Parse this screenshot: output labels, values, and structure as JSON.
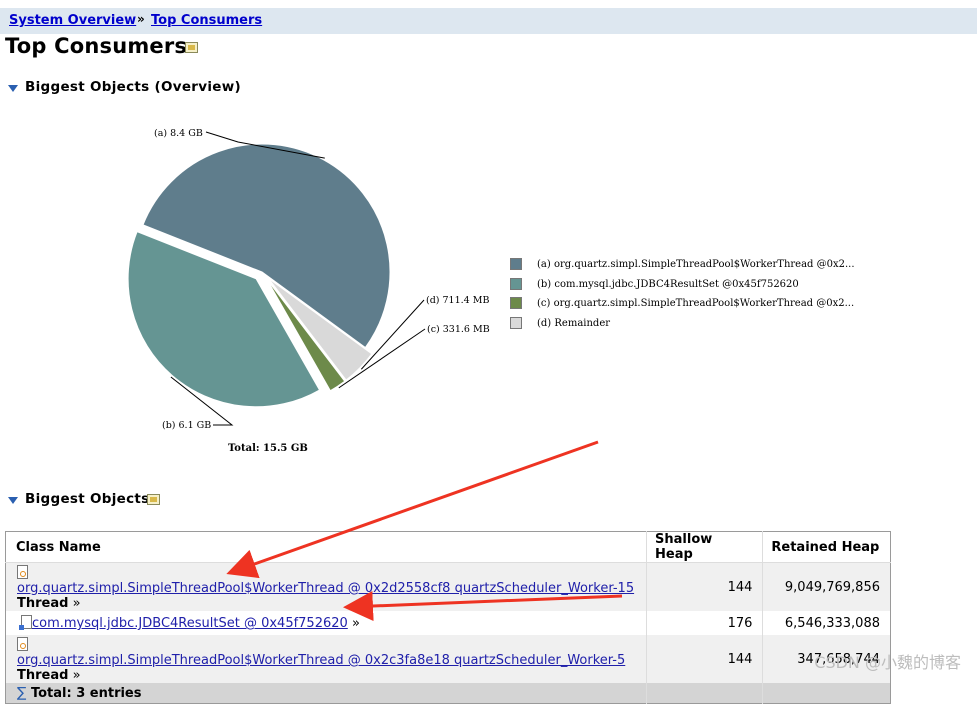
{
  "breadcrumb": {
    "items": [
      "System Overview",
      "Top Consumers"
    ],
    "separator": "»"
  },
  "page_title": "Top Consumers",
  "overview_section": {
    "title": "Biggest Objects (Overview)",
    "pie": {
      "total_label": "Total: 15.5 GB",
      "slices": [
        {
          "id": "a",
          "label": "(a) 8.4 GB",
          "value_gb": 8.4,
          "color": "#5f7d8c",
          "legend": "(a)  org.quartz.simpl.SimpleThreadPool$WorkerThread @0x2..."
        },
        {
          "id": "d",
          "label": "(d) 711.4 MB",
          "value_gb": 0.711,
          "color": "#d9d9d9",
          "legend": "(d)  Remainder"
        },
        {
          "id": "c",
          "label": "(c) 331.6 MB",
          "value_gb": 0.332,
          "color": "#6d8a4a",
          "legend": "(c)  org.quartz.simpl.SimpleThreadPool$WorkerThread @0x2..."
        },
        {
          "id": "b",
          "label": "(b) 6.1 GB",
          "value_gb": 6.1,
          "color": "#659593",
          "legend": "(b)  com.mysql.jdbc.JDBC4ResultSet @0x45f752620"
        }
      ],
      "legend_order": [
        "a",
        "b",
        "c",
        "d"
      ]
    }
  },
  "table_section": {
    "title": "Biggest Objects",
    "columns": [
      "Class Name",
      "Shallow Heap",
      "Retained Heap"
    ],
    "rows": [
      {
        "name": "org.quartz.simpl.SimpleThreadPool$WorkerThread @ 0x2d2558cf8 quartzScheduler_Worker-15",
        "suffix": "Thread",
        "more": "»",
        "shallow": "144",
        "retained": "9,049,769,856"
      },
      {
        "name": "com.mysql.jdbc.JDBC4ResultSet @ 0x45f752620",
        "suffix": "",
        "more": "»",
        "shallow": "176",
        "retained": "6,546,333,088"
      },
      {
        "name": "org.quartz.simpl.SimpleThreadPool$WorkerThread @ 0x2c3fa8e18 quartzScheduler_Worker-5",
        "suffix": "Thread",
        "more": "»",
        "shallow": "144",
        "retained": "347,658,744"
      }
    ],
    "total_sigma": "∑",
    "total_label": "Total: 3 entries"
  },
  "watermark": "CSDN @小魏的博客",
  "colors": {
    "arrow": "#ee3322",
    "link": "#2020aa",
    "header_bg": "#dde7f0"
  }
}
